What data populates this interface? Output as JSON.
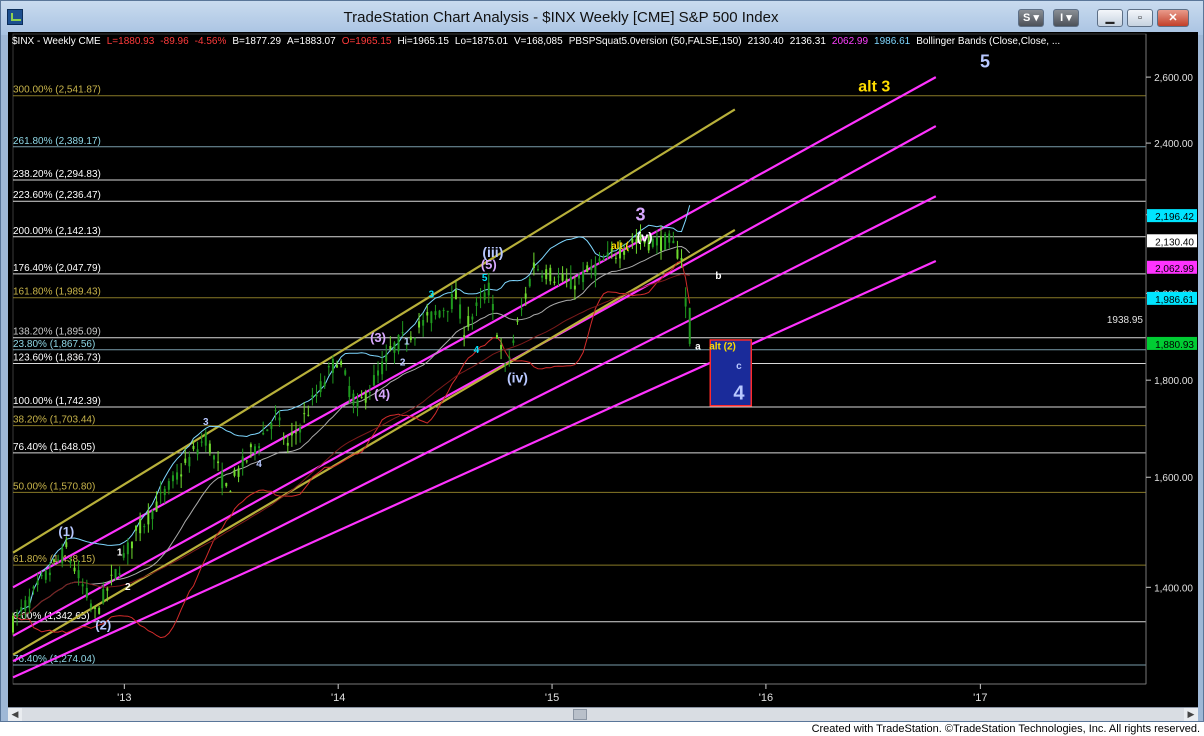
{
  "window": {
    "title": "TradeStation Chart Analysis - $INX Weekly [CME] S&P 500 Index",
    "buttons": [
      "S",
      "I",
      "",
      "",
      ""
    ]
  },
  "header": {
    "items": [
      {
        "text": "$INX - Weekly  CME",
        "color": "#ffffff"
      },
      {
        "text": "L=1880.93",
        "color": "#ff3b3b"
      },
      {
        "text": "-89.96",
        "color": "#ff3b3b"
      },
      {
        "text": "-4.56%",
        "color": "#ff3b3b"
      },
      {
        "text": "B=1877.29",
        "color": "#ffffff"
      },
      {
        "text": "A=1883.07",
        "color": "#ffffff"
      },
      {
        "text": "O=1965.15",
        "color": "#ff3b3b"
      },
      {
        "text": "Hi=1965.15",
        "color": "#ffffff"
      },
      {
        "text": "Lo=1875.01",
        "color": "#ffffff"
      },
      {
        "text": "V=168,085",
        "color": "#ffffff"
      },
      {
        "text": "PBSPSquat5.0version (50,FALSE,150)",
        "color": "#ffffff"
      },
      {
        "text": "2130.40",
        "color": "#ffffff"
      },
      {
        "text": "2136.31",
        "color": "#ffffff"
      },
      {
        "text": "2062.99",
        "color": "#ff40ff"
      },
      {
        "text": "1986.61",
        "color": "#7fd7ff"
      },
      {
        "text": "Bollinger Bands (Close,Close, ...",
        "color": "#ffffff"
      }
    ]
  },
  "chart_data": {
    "type": "candlestick",
    "y_scale": "log",
    "ylim": [
      1245,
      2700
    ],
    "xlim": [
      "2012-06-25",
      "2017-10-09"
    ],
    "y_ticks": [
      1400,
      1600,
      1800,
      2000,
      2200,
      2400,
      2600
    ],
    "y_tick_labels": [
      "1,400.00",
      "1,600.00",
      "1,800.00",
      "2,000.00",
      "2,200.00",
      "2,400.00",
      "2,600.00"
    ],
    "x_ticks": [
      "2013-01-01",
      "2014-01-01",
      "2015-01-01",
      "2016-01-01",
      "2017-01-01"
    ],
    "x_tick_labels": [
      "'13",
      "'14",
      "'15",
      "'16",
      "'17"
    ],
    "weekly_close_path": [
      [
        "2012-06-25",
        1340
      ],
      [
        "2012-08-20",
        1418
      ],
      [
        "2012-09-24",
        1465
      ],
      [
        "2012-11-12",
        1355
      ],
      [
        "2013-01-21",
        1495
      ],
      [
        "2013-05-20",
        1680
      ],
      [
        "2013-06-24",
        1575
      ],
      [
        "2013-09-16",
        1725
      ],
      [
        "2013-10-07",
        1660
      ],
      [
        "2013-12-30",
        1848
      ],
      [
        "2014-02-03",
        1740
      ],
      [
        "2014-04-07",
        1875
      ],
      [
        "2014-07-21",
        1990
      ],
      [
        "2014-08-04",
        1915
      ],
      [
        "2014-09-15",
        2010
      ],
      [
        "2014-10-13",
        1820
      ],
      [
        "2014-12-01",
        2070
      ],
      [
        "2015-02-02",
        2020
      ],
      [
        "2015-05-18",
        2130
      ],
      [
        "2015-07-20",
        2128
      ],
      [
        "2015-08-10",
        2092
      ],
      [
        "2015-08-24",
        1880
      ]
    ],
    "last_bar": {
      "open": 1965.15,
      "high": 1965.15,
      "low": 1875.01,
      "close": 1880.93
    },
    "fib_levels": [
      {
        "label": "300.00% (2,541.87)",
        "value": 2541.87
      },
      {
        "label": "261.80% (2,389.17)",
        "value": 2389.17
      },
      {
        "label": "238.20% (2,294.83)",
        "value": 2294.83
      },
      {
        "label": "223.60% (2,236.47)",
        "value": 2236.47
      },
      {
        "label": "200.00% (2,142.13)",
        "value": 2142.13
      },
      {
        "label": "176.40% (2,047.79)",
        "value": 2047.79
      },
      {
        "label": "161.80% (1,989.43)",
        "value": 1989.43
      },
      {
        "label": "138.20% (1,895.09)",
        "value": 1895.09
      },
      {
        "label": "23.80% (1,867.56)",
        "value": 1867.56
      },
      {
        "label": "123.60% (1,836.73)",
        "value": 1836.73
      },
      {
        "label": "100.00% (1,742.39)",
        "value": 1742.39
      },
      {
        "label": "38.20% (1,703.44)",
        "value": 1703.44
      },
      {
        "label": "76.40% (1,648.05)",
        "value": 1648.05
      },
      {
        "label": "50.00% (1,570.80)",
        "value": 1570.8
      },
      {
        "label": "61.80% (1,438.15)",
        "value": 1438.15
      },
      {
        "label": "0.00% (1,342.65)",
        "value": 1342.65
      },
      {
        "label": "76.40% (1,274.04)",
        "value": 1274.04
      }
    ],
    "channels": [
      {
        "color": "#ff33ff",
        "start": [
          "2012-06-25",
          1400
        ],
        "end": [
          "2016-10-17",
          2600
        ]
      },
      {
        "color": "#ff33ff",
        "start": [
          "2012-06-25",
          1320
        ],
        "end": [
          "2016-10-17",
          2450
        ]
      },
      {
        "color": "#ff33ff",
        "start": [
          "2012-06-25",
          1280
        ],
        "end": [
          "2016-10-17",
          2250
        ]
      },
      {
        "color": "#ff33ff",
        "start": [
          "2012-06-25",
          1255
        ],
        "end": [
          "2016-10-17",
          2080
        ]
      },
      {
        "color": "#b8b03a",
        "start": [
          "2012-06-25",
          1460
        ],
        "end": [
          "2015-11-09",
          2500
        ]
      },
      {
        "color": "#b8b03a",
        "start": [
          "2012-06-25",
          1290
        ],
        "end": [
          "2015-11-09",
          2160
        ]
      }
    ],
    "price_labels": [
      {
        "text": "2,196.42",
        "value": 2196.42,
        "bg": "#00e5ff",
        "fg": "#000000"
      },
      {
        "text": "2,130.40",
        "value": 2130.4,
        "bg": "#ffffff",
        "fg": "#000000"
      },
      {
        "text": "2,062.99",
        "value": 2062.99,
        "bg": "#ff33ff",
        "fg": "#000000"
      },
      {
        "text": "1,986.61",
        "value": 1986.61,
        "bg": "#00e5ff",
        "fg": "#000000"
      },
      {
        "text": "1,880.93",
        "value": 1880.93,
        "bg": "#00cc33",
        "fg": "#000000"
      }
    ],
    "extra_labels": [
      {
        "text": "1938.95",
        "value": 1938.95
      }
    ],
    "wave_labels": [
      {
        "text": "(1)",
        "date": "2012-09-24",
        "value": 1490,
        "color": "#b8c8ff",
        "size": 13
      },
      {
        "text": "(2)",
        "date": "2012-11-26",
        "value": 1330,
        "color": "#b8c8ff",
        "size": 13
      },
      {
        "text": "1",
        "date": "2012-12-24",
        "value": 1455,
        "color": "#ffffff",
        "size": 10
      },
      {
        "text": "2",
        "date": "2013-01-07",
        "value": 1395,
        "color": "#ffffff",
        "size": 10
      },
      {
        "text": "3",
        "date": "2013-05-20",
        "value": 1705,
        "color": "#b8c8ff",
        "size": 10
      },
      {
        "text": "4",
        "date": "2013-08-19",
        "value": 1620,
        "color": "#b8c8ff",
        "size": 10
      },
      {
        "text": "(3)",
        "date": "2014-03-10",
        "value": 1885,
        "color": "#d8a8ff",
        "size": 13
      },
      {
        "text": "(4)",
        "date": "2014-03-17",
        "value": 1760,
        "color": "#d8a8ff",
        "size": 13
      },
      {
        "text": "1",
        "date": "2014-04-28",
        "value": 1880,
        "color": "#b8c8ff",
        "size": 10
      },
      {
        "text": "2",
        "date": "2014-04-21",
        "value": 1832,
        "color": "#b8c8ff",
        "size": 10
      },
      {
        "text": "3",
        "date": "2014-06-09",
        "value": 1990,
        "color": "#00e5ff",
        "size": 10
      },
      {
        "text": "4",
        "date": "2014-08-25",
        "value": 1860,
        "color": "#00e5ff",
        "size": 10
      },
      {
        "text": "5",
        "date": "2014-09-08",
        "value": 2030,
        "color": "#00e5ff",
        "size": 10
      },
      {
        "text": "(5)",
        "date": "2014-09-15",
        "value": 2060,
        "color": "#d8a8ff",
        "size": 13
      },
      {
        "text": "(iii)",
        "date": "2014-09-22",
        "value": 2090,
        "color": "#b8c8ff",
        "size": 14
      },
      {
        "text": "(iv)",
        "date": "2014-11-03",
        "value": 1795,
        "color": "#b8c8ff",
        "size": 14
      },
      {
        "text": "alt (",
        "date": "2015-04-27",
        "value": 2110,
        "color": "#ffdd00",
        "size": 10
      },
      {
        "text": "3",
        "date": "2015-06-01",
        "value": 2185,
        "color": "#d8a8ff",
        "size": 18
      },
      {
        "text": "(v)",
        "date": "2015-06-08",
        "value": 2130,
        "color": "#ffffff",
        "size": 13
      },
      {
        "text": "b",
        "date": "2015-10-12",
        "value": 2035,
        "color": "#ffffff",
        "size": 10
      },
      {
        "text": "a",
        "date": "2015-09-07",
        "value": 1868,
        "color": "#ffffff",
        "size": 10
      },
      {
        "text": "alt (2)",
        "date": "2015-10-19",
        "value": 1868,
        "color": "#ffdd00",
        "size": 10
      },
      {
        "text": "c",
        "date": "2015-11-16",
        "value": 1825,
        "color": "#b8c8ff",
        "size": 10
      },
      {
        "text": "4",
        "date": "2015-11-16",
        "value": 1758,
        "color": "#b8c8ff",
        "size": 20
      },
      {
        "text": "alt 3",
        "date": "2016-07-04",
        "value": 2555,
        "color": "#ffdd00",
        "size": 16
      },
      {
        "text": "5",
        "date": "2017-01-09",
        "value": 2630,
        "color": "#b8c8ff",
        "size": 18
      }
    ],
    "target_box": {
      "x0": "2015-09-28",
      "x1": "2015-12-07",
      "y_top": 1890,
      "y_bottom": 1745,
      "fill": "#1a2b9a",
      "border": "#ff2a2a"
    }
  },
  "footer": {
    "text": "Created with TradeStation. ©TradeStation Technologies, Inc. All rights reserved."
  }
}
